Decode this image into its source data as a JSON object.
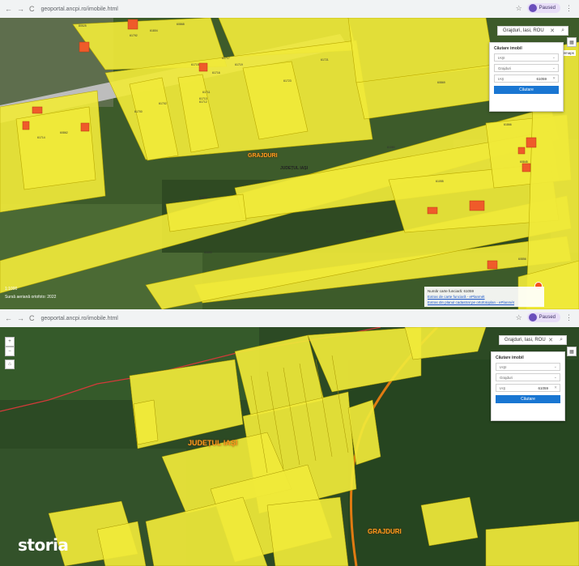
{
  "shot1": {
    "browser": {
      "url": "geoportal.ancpi.ro/imobile.html",
      "profile_label": "Paused",
      "back_glyph": "←",
      "forward_glyph": "→",
      "reload_glyph": "C"
    },
    "search": {
      "value": "Grajduri, Iasi, ROU"
    },
    "panel": {
      "title": "Căutare imobil",
      "county": "IAŞI",
      "uat": "Grajduri",
      "cf_prefix": "IAŞ",
      "cf_number": "61059",
      "button": "Căutare"
    },
    "labels": {
      "village": "GRAJDURI",
      "county": "JUDEȚUL IAȘI",
      "scale": "1:1000",
      "orthophoto": "Sursă aeriană ortofoto: 2022",
      "basemaps": "Basemaps"
    },
    "info": {
      "cf_label": "Număr carte funciară: 61059",
      "link1": "Extras de carte funciară - ePlanmét",
      "link2": "Extras din planul cadastral pe ortofotoplan - ePlanmét"
    },
    "parcels": [
      "80525",
      "61792",
      "61804",
      "60868",
      "61715",
      "61717",
      "61716",
      "61719",
      "61721",
      "61711",
      "61712",
      "61702",
      "61700",
      "61723",
      "61713",
      "61714",
      "60862",
      "61080",
      "61069",
      "61055",
      "61085",
      "60853",
      "60869",
      "61866",
      "60845",
      "60856",
      "60845",
      "60861",
      "60853"
    ],
    "colors": {
      "parcel": "#f0e93a",
      "highlight": "#ef5b2a",
      "button": "#1976d2"
    }
  },
  "shot2": {
    "browser": {
      "url": "geoportal.ancpi.ro/imobile.html",
      "profile_label": "Paused",
      "back_glyph": "←",
      "forward_glyph": "→",
      "reload_glyph": "C"
    },
    "search": {
      "value": "Grajduri, Iasi, ROU"
    },
    "panel": {
      "title": "Căutare imobil",
      "county": "IAŞI",
      "uat": "Grajduri",
      "cf_prefix": "IAŞ",
      "cf_number": "61059",
      "button": "Căutare"
    },
    "labels": {
      "county": "JUDEȚUL IAȘI",
      "village": "GRAJDURI",
      "brand": "storia"
    },
    "colors": {
      "parcel": "#f0e93a",
      "road": "#e07b12",
      "border": "#d43a3a"
    }
  }
}
